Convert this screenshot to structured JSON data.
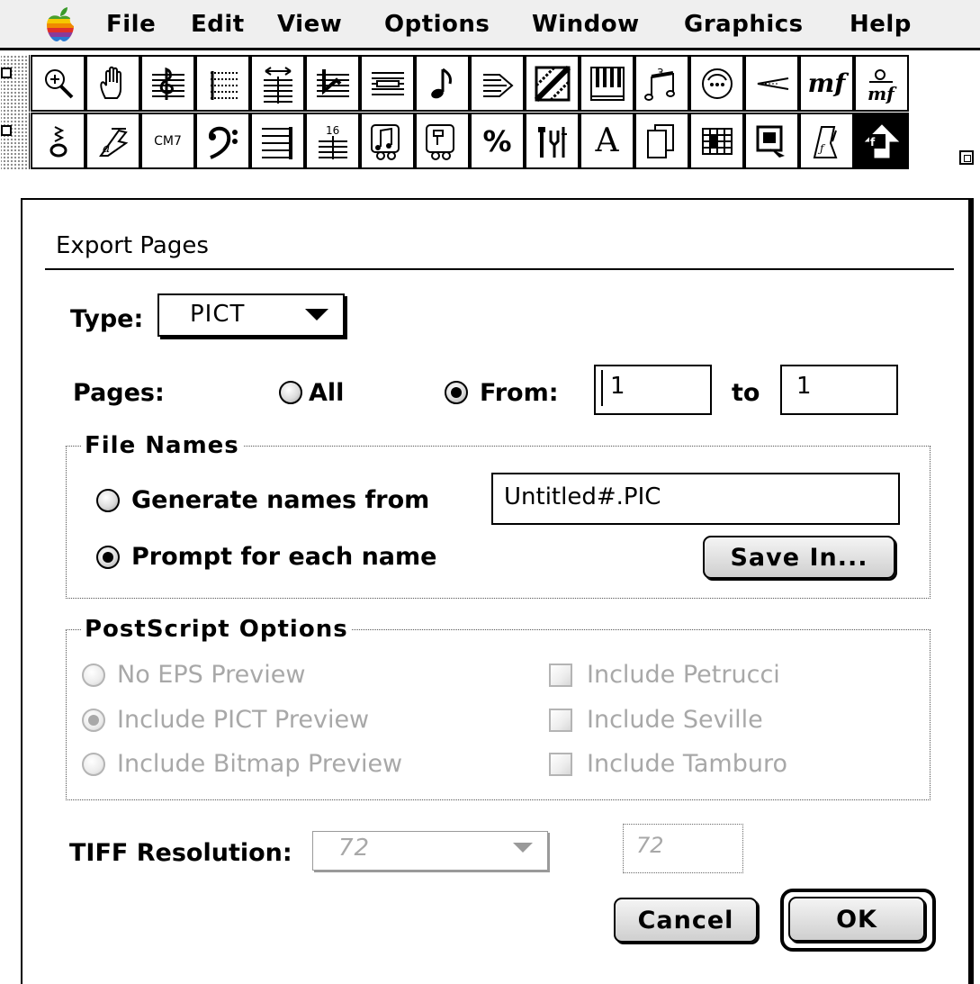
{
  "menubar": {
    "items": [
      "File",
      "Edit",
      "View",
      "Options",
      "Window",
      "Graphics",
      "Help"
    ]
  },
  "palette": {
    "row1": [
      "zoom-tool",
      "hand-grabber-tool",
      "staff-tool",
      "measure-tool",
      "key-signature-tool",
      "time-signature-tool",
      "clef-tool",
      "simple-entry-note-tool",
      "tuplet-tool",
      "shape-tool",
      "midi-tool",
      "articulation-tool",
      "smart-shape-tool",
      "hairpin-tool",
      "expression-tool",
      "staff-expression-tool"
    ],
    "row2": [
      "note-mover-tool",
      "lyrics-tool",
      "chord-tool",
      "bass-clef-tool",
      "repeat-tool",
      "text-block-tool",
      "speedy-entry-tool",
      "hyperscribe-tool",
      "resize-tool",
      "special-tools-tool",
      "text-tool",
      "page-layout-tool",
      "mass-edit-tool",
      "graphics-tool",
      "ossia-tool",
      "selection-tool"
    ],
    "row2_text": {
      "chord": "CM7",
      "page_num": "16"
    }
  },
  "dialog": {
    "title": "Export Pages",
    "type_label": "Type:",
    "type_value": "PICT",
    "pages_label": "Pages:",
    "pages_all": "All",
    "pages_from": "From:",
    "pages_from_value": "1",
    "pages_to": "to",
    "pages_to_value": "1",
    "pages_selected": "from",
    "file_names": {
      "title": "File Names",
      "generate_label": "Generate names from",
      "generate_value": "Untitled#.PIC",
      "prompt_label": "Prompt for each name",
      "selected": "prompt",
      "save_in_button": "Save In..."
    },
    "postscript": {
      "title": "PostScript Options",
      "no_eps": "No EPS Preview",
      "include_pict": "Include PICT Preview",
      "include_bitmap": "Include Bitmap Preview",
      "include_petrucci": "Include Petrucci",
      "include_seville": "Include Seville",
      "include_tamburo": "Include Tamburo",
      "enabled": false
    },
    "tiff_label": "TIFF Resolution:",
    "tiff_popup_value": "72",
    "tiff_field_value": "72",
    "cancel_button": "Cancel",
    "ok_button": "OK"
  },
  "colors": {
    "menubar_bg": "#efefef",
    "disabled_text": "#a8a8a8",
    "button_face": "#dcdcdc"
  }
}
